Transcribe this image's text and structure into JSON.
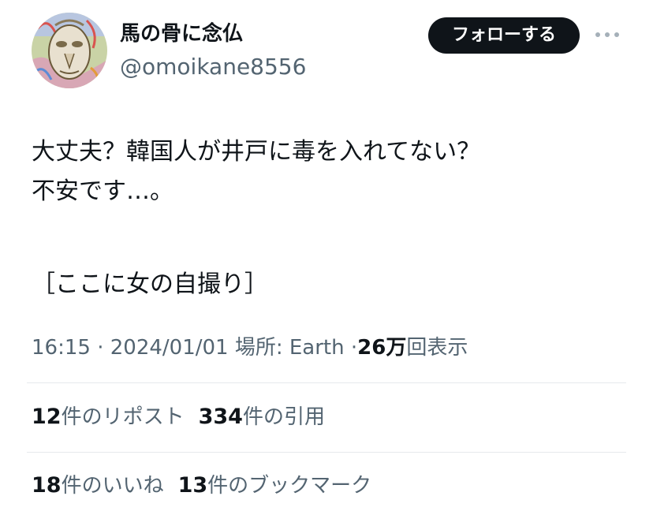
{
  "author": {
    "display_name": "馬の骨に念仏",
    "handle": "@omoikane8556",
    "avatar_icon": "avatar-illustration"
  },
  "actions": {
    "follow_label": "フォローする",
    "more_icon": "ellipsis-icon"
  },
  "tweet": {
    "line1": "大丈夫？韓国人が井戸に毒を入れてない？",
    "line2": "不安です…。",
    "line3": "［ここに女の自撮り］"
  },
  "meta": {
    "time": "16:15",
    "separator": "·",
    "date": "2024/01/01",
    "location": "場所: Earth",
    "views_count": "26万",
    "views_label": "回表示"
  },
  "stats": {
    "reposts_count": "12",
    "reposts_label": "件のリポスト",
    "quotes_count": "334",
    "quotes_label": "件の引用",
    "likes_count": "18",
    "likes_label": "件のいいね",
    "bookmarks_count": "13",
    "bookmarks_label": "件のブックマーク"
  },
  "colors": {
    "text": "#0f1419",
    "secondary": "#536471",
    "button_bg": "#0f1419",
    "divider": "#e6e9ec"
  }
}
